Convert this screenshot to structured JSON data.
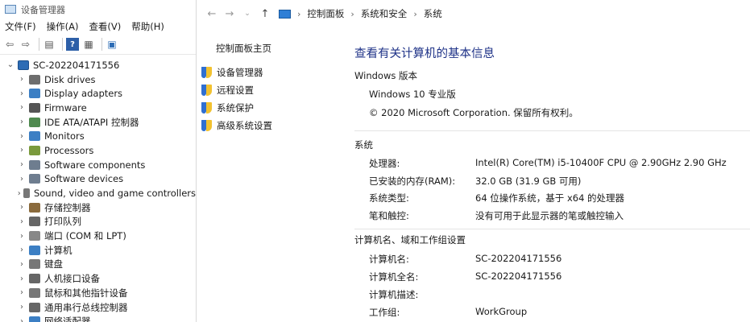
{
  "device_manager": {
    "title": "设备管理器",
    "menu": [
      "文件(F)",
      "操作(A)",
      "查看(V)",
      "帮助(H)"
    ],
    "root_label": "SC-202204171556",
    "categories": [
      {
        "label": "Disk drives",
        "icon": "disk-drive-icon",
        "color": "#6d6d6d"
      },
      {
        "label": "Display adapters",
        "icon": "display-adapter-icon",
        "color": "#3c7fc4"
      },
      {
        "label": "Firmware",
        "icon": "firmware-icon",
        "color": "#555555"
      },
      {
        "label": "IDE ATA/ATAPI 控制器",
        "icon": "ide-controller-icon",
        "color": "#4f8a4f"
      },
      {
        "label": "Monitors",
        "icon": "monitor-icon",
        "color": "#3c7fc4"
      },
      {
        "label": "Processors",
        "icon": "processor-icon",
        "color": "#7a9a3c"
      },
      {
        "label": "Software components",
        "icon": "software-component-icon",
        "color": "#6e7d8f"
      },
      {
        "label": "Software devices",
        "icon": "software-device-icon",
        "color": "#6e7d8f"
      },
      {
        "label": "Sound, video and game controllers",
        "icon": "speaker-icon",
        "color": "#777777"
      },
      {
        "label": "存储控制器",
        "icon": "storage-controller-icon",
        "color": "#8a6a3c"
      },
      {
        "label": "打印队列",
        "icon": "printer-icon",
        "color": "#666666"
      },
      {
        "label": "端口 (COM 和 LPT)",
        "icon": "port-icon",
        "color": "#888888"
      },
      {
        "label": "计算机",
        "icon": "computer-icon",
        "color": "#3c7fc4"
      },
      {
        "label": "键盘",
        "icon": "keyboard-icon",
        "color": "#777777"
      },
      {
        "label": "人机接口设备",
        "icon": "hid-icon",
        "color": "#666666"
      },
      {
        "label": "鼠标和其他指针设备",
        "icon": "mouse-icon",
        "color": "#777777"
      },
      {
        "label": "通用串行总线控制器",
        "icon": "usb-icon",
        "color": "#666666"
      },
      {
        "label": "网络适配器",
        "icon": "network-adapter-icon",
        "color": "#3c7fc4"
      }
    ]
  },
  "control_panel": {
    "breadcrumb": [
      "控制面板",
      "系统和安全",
      "系统"
    ],
    "sidebar": {
      "home": "控制面板主页",
      "links": [
        "设备管理器",
        "远程设置",
        "系统保护",
        "高级系统设置"
      ]
    },
    "heading": "查看有关计算机的基本信息",
    "windows_edition": {
      "section": "Windows 版本",
      "edition": "Windows 10 专业版",
      "copyright": "© 2020 Microsoft Corporation. 保留所有权利。"
    },
    "system": {
      "section": "系统",
      "rows": [
        {
          "label": "处理器:",
          "value": "Intel(R) Core(TM) i5-10400F CPU @ 2.90GHz   2.90 GHz"
        },
        {
          "label": "已安装的内存(RAM):",
          "value": "32.0 GB (31.9 GB 可用)"
        },
        {
          "label": "系统类型:",
          "value": "64 位操作系统，基于 x64 的处理器"
        },
        {
          "label": "笔和触控:",
          "value": "没有可用于此显示器的笔或触控输入"
        }
      ]
    },
    "computer_name": {
      "section": "计算机名、域和工作组设置",
      "rows": [
        {
          "label": "计算机名:",
          "value": "SC-202204171556"
        },
        {
          "label": "计算机全名:",
          "value": "SC-202204171556"
        },
        {
          "label": "计算机描述:",
          "value": ""
        },
        {
          "label": "工作组:",
          "value": "WorkGroup"
        }
      ]
    }
  }
}
